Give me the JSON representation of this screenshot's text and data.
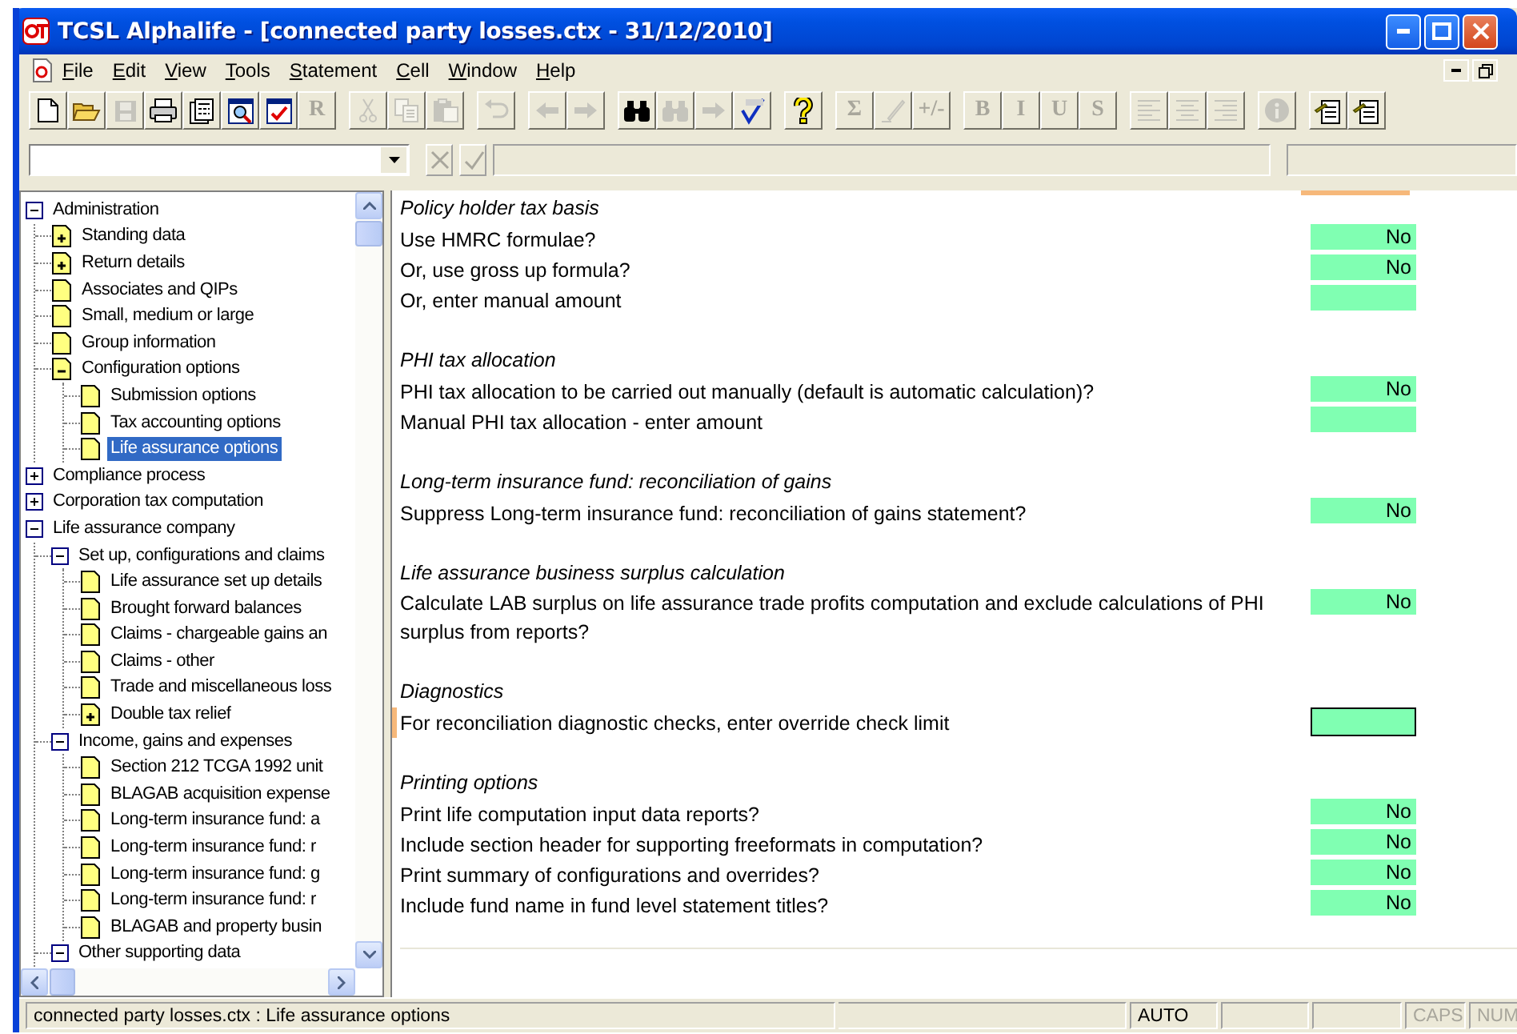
{
  "window": {
    "title": "TCSL Alphalife - [connected party losses.ctx - 31/12/2010]"
  },
  "menu": [
    "File",
    "Edit",
    "View",
    "Tools",
    "Statement",
    "Cell",
    "Window",
    "Help"
  ],
  "toolbar": [
    [
      {
        "kind": "new",
        "disabled": false
      },
      {
        "kind": "open",
        "disabled": false
      },
      {
        "kind": "save",
        "disabled": true
      },
      {
        "kind": "print",
        "disabled": false
      },
      {
        "kind": "calculator",
        "disabled": false
      },
      {
        "kind": "preview",
        "disabled": false
      },
      {
        "kind": "check",
        "disabled": false
      },
      {
        "label": "R",
        "disabled": true
      }
    ],
    [
      {
        "kind": "cut",
        "disabled": true
      },
      {
        "kind": "copy",
        "disabled": true
      },
      {
        "kind": "paste",
        "disabled": true
      }
    ],
    [
      {
        "kind": "undo",
        "disabled": true
      }
    ],
    [
      {
        "kind": "back",
        "disabled": true
      },
      {
        "kind": "forward",
        "disabled": true
      }
    ],
    [
      {
        "kind": "find",
        "disabled": false
      },
      {
        "kind": "findnext",
        "disabled": true
      },
      {
        "kind": "goto",
        "disabled": true
      },
      {
        "kind": "spell",
        "disabled": false
      }
    ],
    [
      {
        "kind": "help",
        "disabled": false
      }
    ],
    [
      {
        "label": "Σ",
        "disabled": true
      },
      {
        "kind": "pen",
        "disabled": true
      },
      {
        "label": "+/-",
        "disabled": true
      }
    ],
    [
      {
        "label": "B",
        "disabled": true
      },
      {
        "label": "I",
        "disabled": true
      },
      {
        "label": "U",
        "disabled": true
      },
      {
        "label": "S",
        "disabled": true
      }
    ],
    [
      {
        "kind": "alignleft",
        "disabled": true
      },
      {
        "kind": "center",
        "disabled": true
      },
      {
        "kind": "alignright",
        "disabled": true
      }
    ],
    [
      {
        "kind": "info",
        "disabled": true
      }
    ],
    [
      {
        "kind": "note",
        "disabled": false
      },
      {
        "kind": "notehelp",
        "disabled": false
      }
    ]
  ],
  "tree": [
    {
      "label": "Administration",
      "kind": "section",
      "expanded": true,
      "selected": false,
      "children": [
        {
          "label": "Standing data",
          "kind": "page",
          "expanded": false,
          "selected": false
        },
        {
          "label": "Return details",
          "kind": "page",
          "expanded": false,
          "selected": false
        },
        {
          "label": "Associates and QIPs",
          "kind": "page",
          "selected": false
        },
        {
          "label": "Small, medium or large",
          "kind": "page",
          "selected": false
        },
        {
          "label": "Group information",
          "kind": "page",
          "selected": false
        },
        {
          "label": "Configuration options",
          "kind": "page",
          "expanded": true,
          "selected": false,
          "children": [
            {
              "label": "Submission options",
              "kind": "page",
              "selected": false
            },
            {
              "label": "Tax accounting options",
              "kind": "page",
              "selected": false
            },
            {
              "label": "Life assurance options",
              "kind": "page",
              "selected": true
            }
          ]
        }
      ]
    },
    {
      "label": "Compliance process",
      "kind": "section",
      "expanded": false,
      "selected": false
    },
    {
      "label": "Corporation tax computation",
      "kind": "section",
      "expanded": false,
      "selected": false
    },
    {
      "label": "Life assurance company",
      "kind": "section",
      "expanded": true,
      "selected": false,
      "children": [
        {
          "label": "Set up, configurations and claims",
          "kind": "section",
          "expanded": true,
          "selected": false,
          "children": [
            {
              "label": "Life assurance set up details",
              "kind": "page",
              "selected": false
            },
            {
              "label": "Brought forward balances",
              "kind": "page",
              "selected": false
            },
            {
              "label": "Claims - chargeable gains an",
              "kind": "page",
              "selected": false
            },
            {
              "label": "Claims - other",
              "kind": "page",
              "selected": false
            },
            {
              "label": "Trade and miscellaneous loss",
              "kind": "page",
              "selected": false
            },
            {
              "label": "Double tax relief",
              "kind": "page",
              "expanded": false,
              "selected": false
            }
          ]
        },
        {
          "label": "Income, gains and expenses",
          "kind": "section",
          "expanded": true,
          "selected": false,
          "children": [
            {
              "label": "Section 212 TCGA 1992 unit",
              "kind": "page",
              "selected": false
            },
            {
              "label": "BLAGAB acquisition expense",
              "kind": "page",
              "selected": false
            },
            {
              "label": "Long-term insurance fund: a",
              "kind": "page",
              "selected": false
            },
            {
              "label": "Long-term insurance fund: r",
              "kind": "page",
              "selected": false
            },
            {
              "label": "Long-term insurance fund: g",
              "kind": "page",
              "selected": false
            },
            {
              "label": "Long-term insurance fund: r",
              "kind": "page",
              "selected": false
            },
            {
              "label": "BLAGAB and property busin",
              "kind": "page",
              "selected": false
            }
          ]
        },
        {
          "label": "Other supporting data",
          "kind": "section",
          "expanded": true,
          "selected": false
        }
      ]
    }
  ],
  "sections": [
    {
      "title": "Policy holder tax basis",
      "rows": [
        {
          "label": "Use HMRC formulae?",
          "value": "No",
          "focused": false
        },
        {
          "label": "Or, use gross up formula?",
          "value": "No",
          "focused": false
        },
        {
          "label": "Or, enter manual amount",
          "focused": false
        }
      ]
    },
    {
      "title": "PHI tax allocation",
      "rows": [
        {
          "label": "PHI tax allocation to be carried out manually (default is automatic calculation)?",
          "value": "No",
          "focused": false
        },
        {
          "label": "Manual PHI tax allocation  - enter amount",
          "focused": false
        }
      ]
    },
    {
      "title": "Long-term insurance fund: reconciliation of gains",
      "rows": [
        {
          "label": "Suppress Long-term insurance fund: reconciliation of gains statement?",
          "value": "No",
          "focused": false
        }
      ]
    },
    {
      "title": "Life assurance business surplus calculation",
      "rows": [
        {
          "label": "Calculate LAB surplus on life assurance trade profits computation and exclude calculations of PHI surplus from reports?",
          "value": "No",
          "focused": false
        }
      ]
    },
    {
      "title": "Diagnostics",
      "rows": [
        {
          "label": "For reconciliation diagnostic checks, enter override check limit",
          "focused": true
        }
      ]
    },
    {
      "title": "Printing options",
      "rows": [
        {
          "label": "Print life computation input data reports?",
          "value": "No",
          "focused": false
        },
        {
          "label": "Include section header for supporting freeformats in computation?",
          "value": "No",
          "focused": false
        },
        {
          "label": "Print summary of configurations and overrides?",
          "value": "No",
          "focused": false
        },
        {
          "label": "Include fund name in fund level statement titles?",
          "value": "No",
          "focused": false
        }
      ]
    }
  ],
  "status_bar": [
    {
      "text": "connected party losses.ctx : Life assurance options",
      "disabled": false
    },
    {
      "text": "AUTO",
      "disabled": false
    },
    {
      "text": "CAPS",
      "disabled": true
    },
    {
      "text": "NUM",
      "disabled": true
    }
  ]
}
